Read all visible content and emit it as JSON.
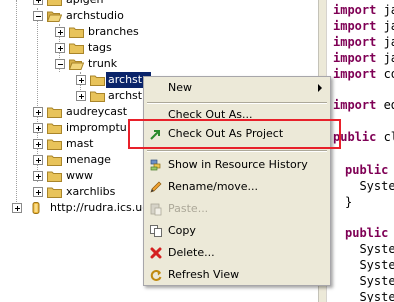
{
  "tree": {
    "items": [
      {
        "label": "apigen"
      },
      {
        "label": "archstudio"
      },
      {
        "label": "branches"
      },
      {
        "label": "tags"
      },
      {
        "label": "trunk"
      },
      {
        "label": "archstu"
      },
      {
        "label": "archstu"
      },
      {
        "label": "audreycast"
      },
      {
        "label": "impromptu"
      },
      {
        "label": "mast"
      },
      {
        "label": "menage"
      },
      {
        "label": "www"
      },
      {
        "label": "xarchlibs"
      },
      {
        "label": "http://rudra.ics.uci"
      }
    ]
  },
  "editor": {
    "lines": [
      {
        "kw": "import",
        "rest": " ja"
      },
      {
        "kw": "import",
        "rest": " ja"
      },
      {
        "kw": "import",
        "rest": " ja"
      },
      {
        "kw": "import",
        "rest": " ja"
      },
      {
        "kw": "import",
        "rest": " co"
      },
      {
        "kw": "import",
        "rest": " ed"
      },
      {
        "kw": "public",
        "rest": " cl"
      },
      {
        "kw": "public",
        "rest": " "
      },
      {
        "kw": "",
        "rest": "  Syste"
      },
      {
        "kw": "",
        "rest": "}"
      },
      {
        "kw": "public",
        "rest": " "
      },
      {
        "kw": "",
        "rest": "  Syste"
      },
      {
        "kw": "",
        "rest": "  Syste"
      },
      {
        "kw": "",
        "rest": "  Syste"
      },
      {
        "kw": "",
        "rest": "  Syste"
      }
    ]
  },
  "context_menu": {
    "new": "New",
    "check_out_as": "Check Out As...",
    "check_out_as_project": "Check Out As Project",
    "show_history": "Show in Resource History",
    "rename_move": "Rename/move...",
    "paste": "Paste...",
    "copy": "Copy",
    "delete": "Delete...",
    "refresh_view": "Refresh View"
  },
  "colors": {
    "selection": "#0a246a",
    "menu_bg": "#ece9d8",
    "highlight_box": "#e8202a",
    "keyword": "#7f0055",
    "folder": "#e8c35a"
  }
}
